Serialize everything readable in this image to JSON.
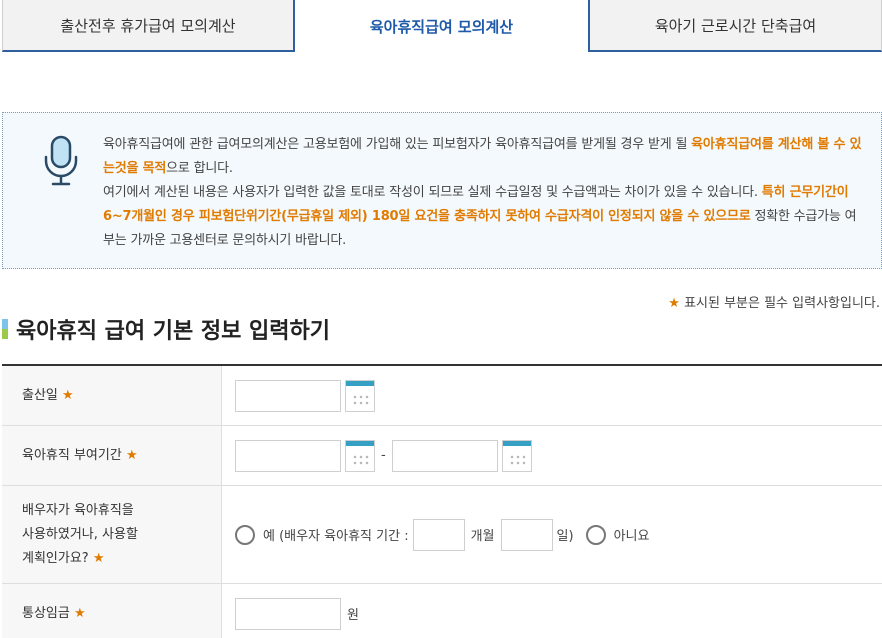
{
  "tabs": [
    {
      "label": "출산전후 휴가급여 모의계산"
    },
    {
      "label": "육아휴직급여 모의계산"
    },
    {
      "label": "육아기 근로시간 단축급여"
    }
  ],
  "notice": {
    "p1_a": "육아휴직급여에 관한 급여모의계산은 고용보험에 가입해 있는 피보험자가 육아휴직급여를 받게될 경우 받게 될 ",
    "p1_b": "육아휴직급여를 계산해 볼 수 있는것을 목적",
    "p1_c": "으로 합니다.",
    "p2_a": "여기에서 계산된 내용은 사용자가 입력한 값을 토대로 작성이 되므로 실제 수급일정 및 수급액과는 차이가 있을 수 있습니다. ",
    "p2_b": "특히 근무기간이 6~7개월인 경우 피보험단위기간(무급휴일 제외) 180일 요건을 충족하지 못하여 수급자격이 인정되지 않을 수 있으므로",
    "p2_c": " 정확한 수급가능 여부는 가까운 고용센터로 문의하시기 바랍니다."
  },
  "required_note": {
    "star": "★",
    "text": " 표시된 부분은 필수 입력사항입니다."
  },
  "section": {
    "title": "육아휴직 급여 기본 정보 입력하기"
  },
  "form": {
    "birth_date": {
      "label": "출산일",
      "star": "★",
      "value": ""
    },
    "leave_period": {
      "label": "육아휴직 부여기간",
      "star": "★",
      "start": "",
      "dash": "-",
      "end": ""
    },
    "spouse": {
      "label_line1": "배우자가 육아휴직을",
      "label_line2": "사용하였거나, 사용할",
      "label_line3": "계획인가요?",
      "star": "★",
      "yes_prefix": "예 (배우자 육아휴직 기간 :",
      "months_unit": "개월",
      "days_unit": "일)",
      "no_label": "아니요",
      "months_value": "",
      "days_value": ""
    },
    "wage": {
      "label": "통상임금",
      "star": "★",
      "value": "",
      "unit": "원"
    }
  },
  "colors": {
    "accent_blue": "#1f5aa8",
    "highlight_orange": "#e07b00",
    "calendar_bar": "#35a0c4"
  }
}
